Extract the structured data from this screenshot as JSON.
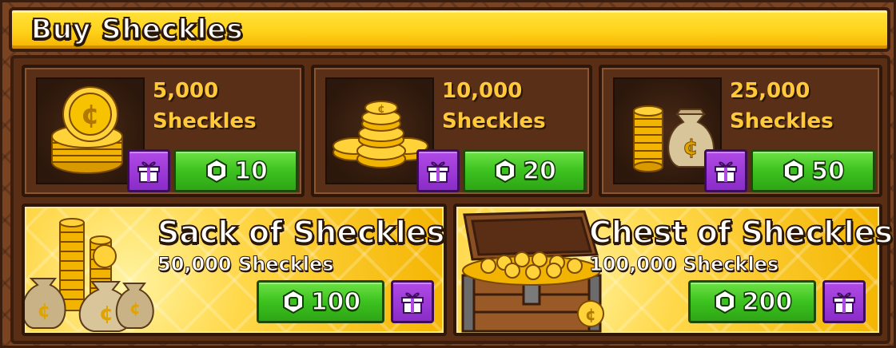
{
  "header": {
    "title": "Buy Sheckles"
  },
  "offers": [
    {
      "amount_number": "5,000",
      "amount_unit": "Sheckles",
      "price": "10",
      "image": "coin-stack-icon"
    },
    {
      "amount_number": "10,000",
      "amount_unit": "Sheckles",
      "price": "20",
      "image": "coin-pile-icon"
    },
    {
      "amount_number": "25,000",
      "amount_unit": "Sheckles",
      "price": "50",
      "image": "coin-bag-icon"
    }
  ],
  "bundles": [
    {
      "title": "Sack of Sheckles",
      "subtitle": "50,000 Sheckles",
      "price": "100",
      "image": "sacks-of-coins-icon"
    },
    {
      "title": "Chest of Sheckles",
      "subtitle": "100,000 Sheckles",
      "price": "200",
      "image": "treasure-chest-icon"
    }
  ],
  "colors": {
    "frame": "#7a4322",
    "header": "#ffd21a",
    "buy_button": "#3cc21f",
    "gift_button": "#9b3ad8",
    "amount_text": "#ffc93a"
  },
  "icons": {
    "currency": "robux-icon",
    "gift": "gift-icon"
  }
}
